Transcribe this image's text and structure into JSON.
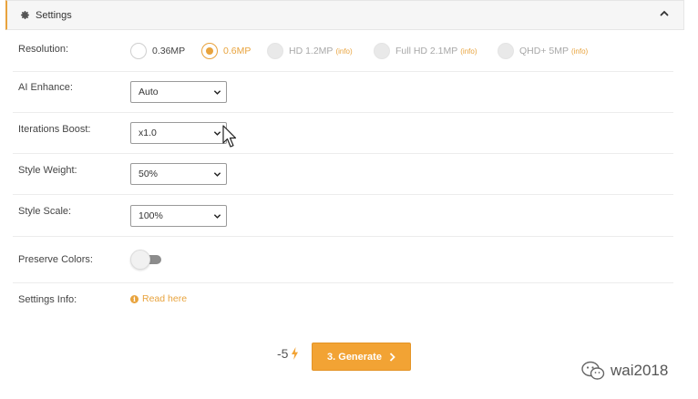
{
  "panel": {
    "title": "Settings"
  },
  "resolution": {
    "label": "Resolution:",
    "options": [
      {
        "label": "0.36MP",
        "state": "unselected",
        "info": ""
      },
      {
        "label": "0.6MP",
        "state": "selected",
        "info": ""
      },
      {
        "label": "HD 1.2MP",
        "state": "disabled",
        "info": "(info)"
      },
      {
        "label": "Full HD 2.1MP",
        "state": "disabled",
        "info": "(info)"
      },
      {
        "label": "QHD+ 5MP",
        "state": "disabled",
        "info": "(info)"
      }
    ]
  },
  "ai_enhance": {
    "label": "AI Enhance:",
    "value": "Auto"
  },
  "iterations_boost": {
    "label": "Iterations Boost:",
    "value": "x1.0"
  },
  "style_weight": {
    "label": "Style Weight:",
    "value": "50%"
  },
  "style_scale": {
    "label": "Style Scale:",
    "value": "100%"
  },
  "preserve_colors": {
    "label": "Preserve Colors:",
    "enabled": false
  },
  "settings_info": {
    "label": "Settings Info:",
    "link_text": "Read here"
  },
  "footer": {
    "cost": "-5",
    "generate_label": "3. Generate"
  },
  "watermark": {
    "text": "wai2018"
  },
  "colors": {
    "accent": "#e8a33d",
    "button": "#f2a334"
  }
}
